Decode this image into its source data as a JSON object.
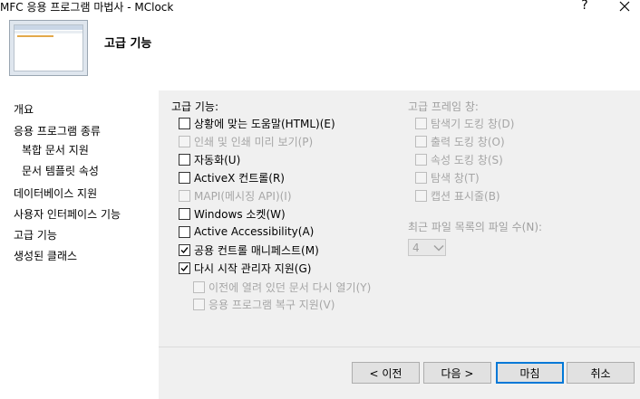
{
  "window": {
    "title": "MFC 응용 프로그램 마법사 - MClock",
    "help": "?"
  },
  "banner": {
    "title": "고급 기능"
  },
  "nav": {
    "items": [
      {
        "label": "개요"
      },
      {
        "label": "응용 프로그램 종류"
      },
      {
        "label": "복합 문서 지원"
      },
      {
        "label": "문서 템플릿 속성"
      },
      {
        "label": "데이터베이스 지원"
      },
      {
        "label": "사용자 인터페이스 기능"
      },
      {
        "label": "고급 기능"
      },
      {
        "label": "생성된 클래스"
      }
    ]
  },
  "advanced": {
    "heading": "고급 기능:",
    "options": [
      {
        "label": "상황에 맞는 도움말(HTML)(E)",
        "checked": false,
        "enabled": true
      },
      {
        "label": "인쇄 및 인쇄 미리 보기(P)",
        "checked": false,
        "enabled": false
      },
      {
        "label": "자동화(U)",
        "checked": false,
        "enabled": true
      },
      {
        "label": "ActiveX 컨트롤(R)",
        "checked": false,
        "enabled": true
      },
      {
        "label": "MAPI(메시징 API)(I)",
        "checked": false,
        "enabled": false
      },
      {
        "label": "Windows 소켓(W)",
        "checked": false,
        "enabled": true
      },
      {
        "label": "Active Accessibility(A)",
        "checked": false,
        "enabled": true
      },
      {
        "label": "공용 컨트롤 매니페스트(M)",
        "checked": true,
        "enabled": true
      },
      {
        "label": "다시 시작 관리자 지원(G)",
        "checked": true,
        "enabled": true
      },
      {
        "label": "이전에 열려 있던 문서 다시 열기(Y)",
        "checked": false,
        "enabled": false
      },
      {
        "label": "응용 프로그램 복구 지원(V)",
        "checked": false,
        "enabled": false
      }
    ]
  },
  "frame_panes": {
    "heading": "고급 프레임 창:",
    "options": [
      {
        "label": "탐색기 도킹 창(D)",
        "checked": false,
        "enabled": false
      },
      {
        "label": "출력 도킹 창(O)",
        "checked": false,
        "enabled": false
      },
      {
        "label": "속성 도킹 창(S)",
        "checked": false,
        "enabled": false
      },
      {
        "label": "탐색 창(T)",
        "checked": false,
        "enabled": false
      },
      {
        "label": "캡션 표시줄(B)",
        "checked": false,
        "enabled": false
      }
    ]
  },
  "mru": {
    "label": "최근 파일 목록의 파일 수(N):",
    "value": "4"
  },
  "buttons": {
    "prev": "< 이전",
    "next": "다음 >",
    "finish": "마침",
    "cancel": "취소"
  }
}
